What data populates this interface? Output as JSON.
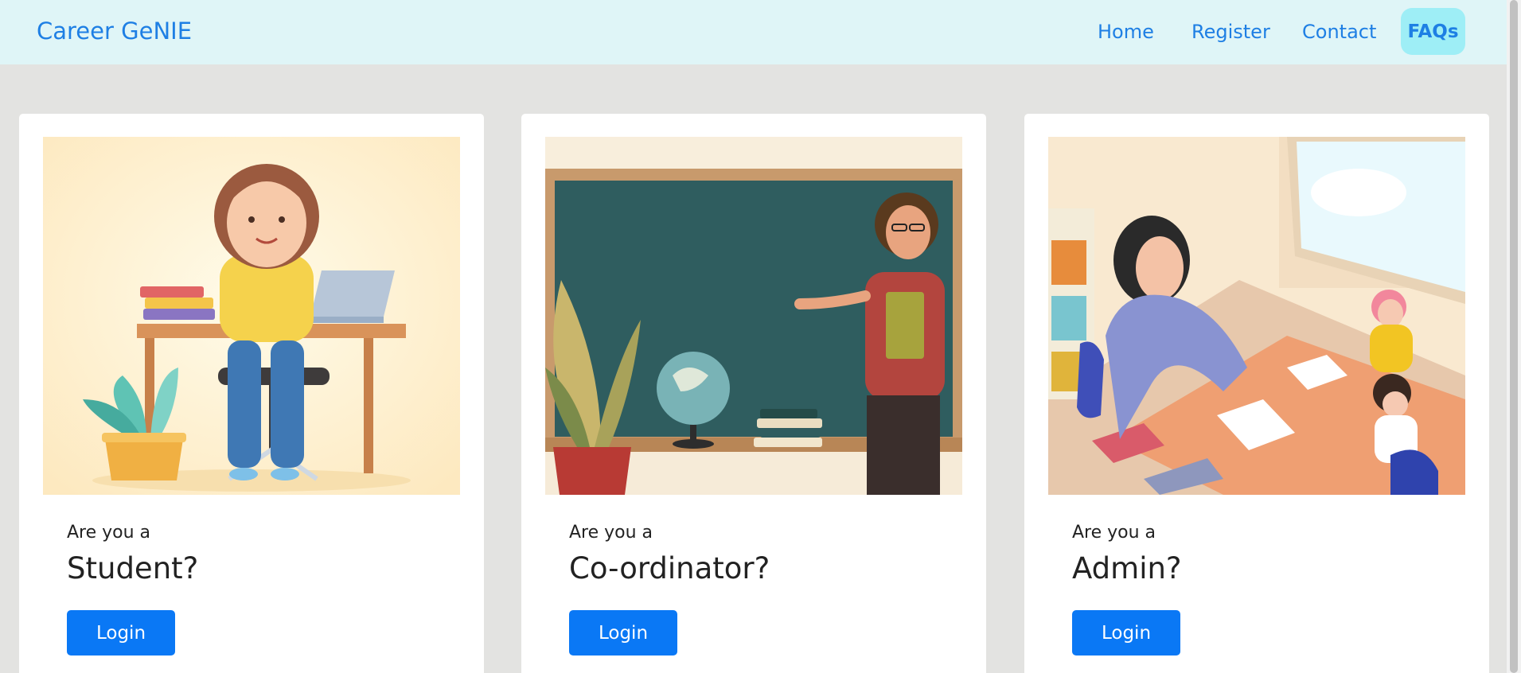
{
  "navbar": {
    "brand": "Career GeNIE",
    "links": {
      "home": "Home",
      "register": "Register",
      "contact": "Contact",
      "faqs": "FAQs"
    }
  },
  "cards": [
    {
      "pre_label": "Are you a",
      "role": "Student?",
      "button": "Login",
      "image": "student-at-desk-illustration"
    },
    {
      "pre_label": "Are you a",
      "role": "Co-ordinator?",
      "button": "Login",
      "image": "teacher-at-chalkboard-illustration"
    },
    {
      "pre_label": "Are you a",
      "role": "Admin?",
      "button": "Login",
      "image": "teacher-with-children-illustration"
    }
  ],
  "colors": {
    "navbar_bg": "#dff5f7",
    "page_bg": "#e3e3e1",
    "link": "#1e7fe4",
    "faqs_pill": "#9eeef6",
    "button": "#0a78f5"
  }
}
